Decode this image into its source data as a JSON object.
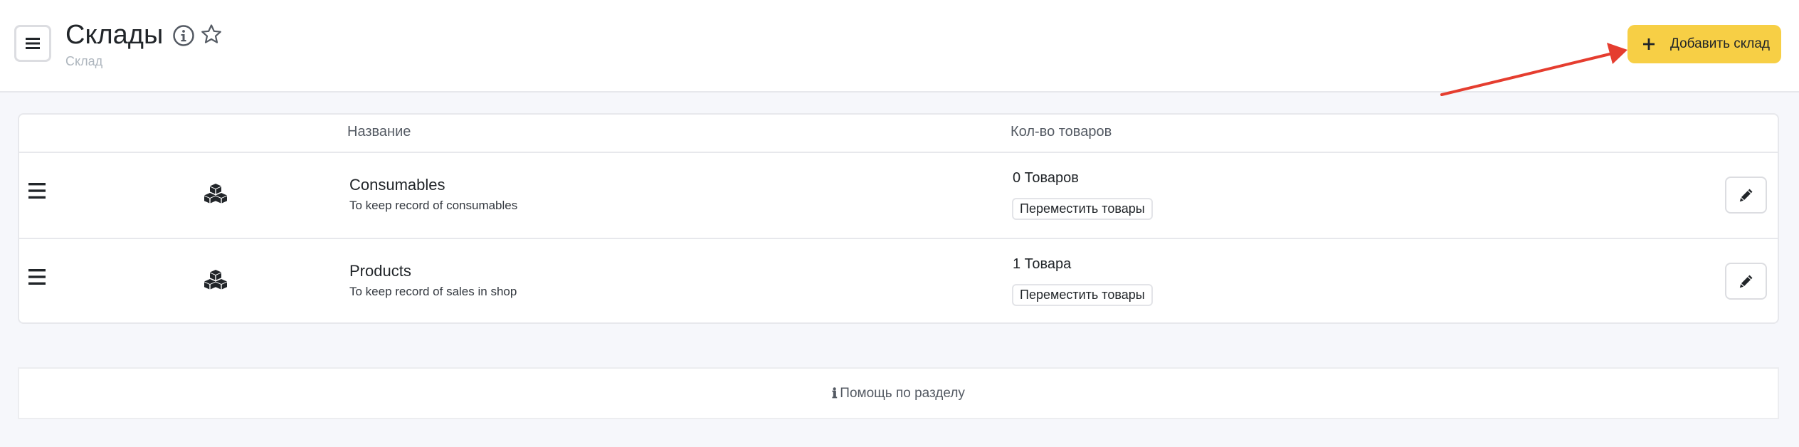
{
  "header": {
    "title": "Склады",
    "breadcrumb": "Склад",
    "add_button_label": "Добавить склад"
  },
  "table": {
    "columns": [
      "Название",
      "Кол-во товаров"
    ],
    "rows": [
      {
        "name": "Consumables",
        "description": "To keep record of consumables",
        "count_label": "0 Товаров",
        "move_button_label": "Переместить товары"
      },
      {
        "name": "Products",
        "description": "To keep record of sales in shop",
        "count_label": "1 Товара",
        "move_button_label": "Переместить товары"
      }
    ]
  },
  "help": {
    "label": "Помощь по разделу",
    "icon": "info-icon"
  },
  "icons": {
    "menu": "hamburger-icon",
    "info": "info-circle-icon",
    "favorite": "star-icon",
    "add": "plus-icon",
    "drag": "drag-handle-icon",
    "warehouse": "boxes-icon",
    "edit": "pencil-icon"
  },
  "colors": {
    "accent": "#f7cf45",
    "annotation_arrow": "#e53d2f",
    "background": "#f6f7fb"
  }
}
